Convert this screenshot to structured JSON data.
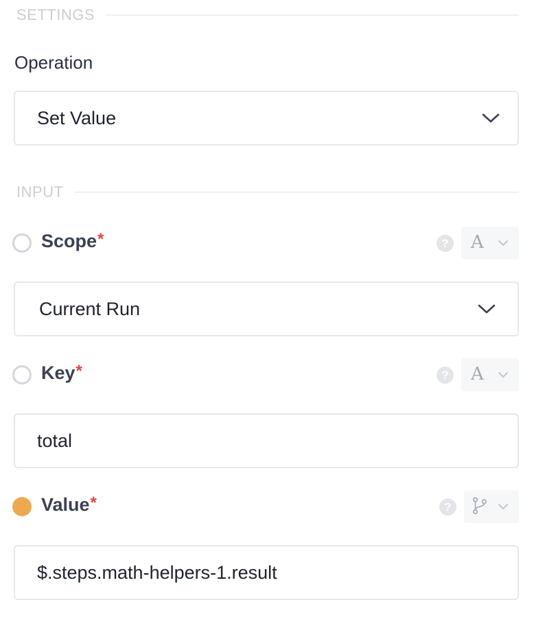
{
  "settings": {
    "section_title": "SETTINGS",
    "operation_label": "Operation",
    "operation_value": "Set Value"
  },
  "input": {
    "section_title": "INPUT",
    "fields": [
      {
        "label": "Scope",
        "required_mark": "*",
        "value": "Current Run",
        "kind": "select",
        "type_glyph": "A",
        "help_glyph": "?",
        "state": "empty"
      },
      {
        "label": "Key",
        "required_mark": "*",
        "value": "total",
        "kind": "text",
        "type_glyph": "A",
        "help_glyph": "?",
        "state": "empty"
      },
      {
        "label": "Value",
        "required_mark": "*",
        "value": "$.steps.math-helpers-1.result",
        "kind": "text",
        "type_glyph": "branch-icon",
        "help_glyph": "?",
        "state": "filled"
      }
    ]
  },
  "colors": {
    "accent_orange": "#eea84f",
    "required_red": "#e0463e",
    "border": "#e6e8ec",
    "section_title": "#cbced6"
  }
}
